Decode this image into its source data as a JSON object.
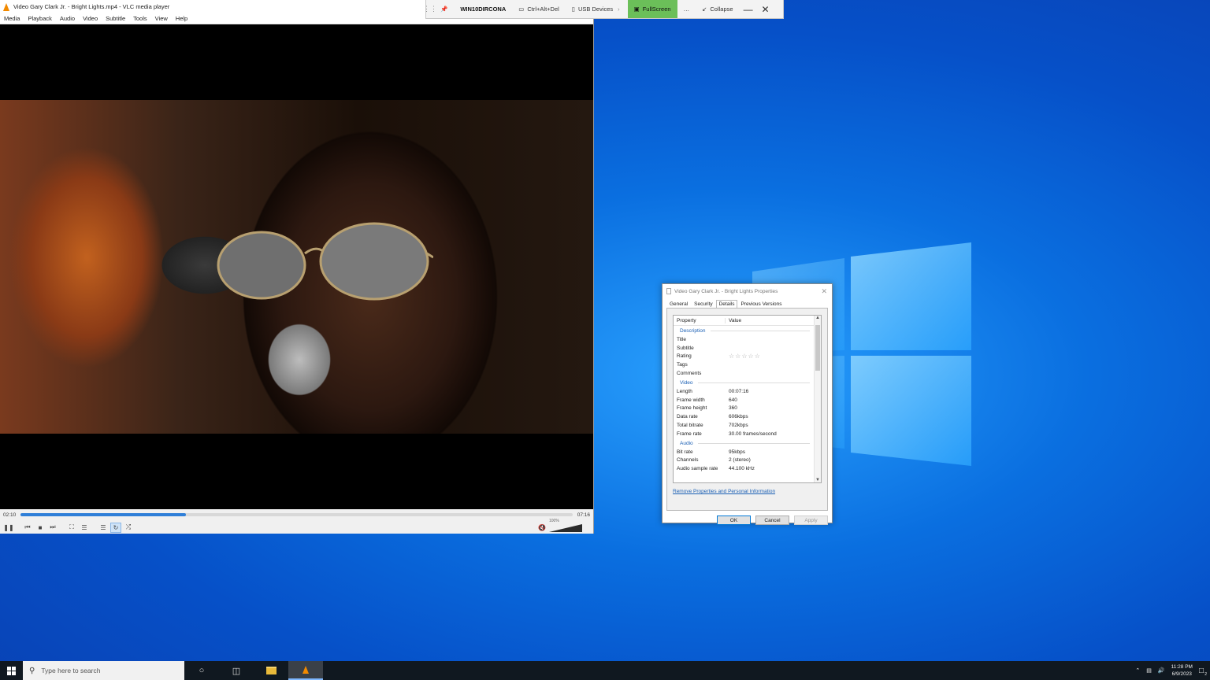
{
  "rdp_toolbar": {
    "machine": "WIN10DIRCONA",
    "ctrl_alt_del": "Ctrl+Alt+Del",
    "usb": "USB Devices",
    "fullscreen": "FullScreen",
    "more": "…",
    "collapse": "Collapse"
  },
  "vlc": {
    "title": "Video Gary Clark Jr. - Bright Lights.mp4 - VLC media player",
    "menu": [
      "Media",
      "Playback",
      "Audio",
      "Video",
      "Subtitle",
      "Tools",
      "View",
      "Help"
    ],
    "time_elapsed": "02:10",
    "time_total": "07:16",
    "progress": 0.3,
    "volume_label": "100%"
  },
  "properties": {
    "title": "Video Gary Clark Jr. - Bright Lights Properties",
    "tabs": [
      "General",
      "Security",
      "Details",
      "Previous Versions"
    ],
    "header_property": "Property",
    "header_value": "Value",
    "sections": {
      "description": "Description",
      "video": "Video",
      "audio": "Audio"
    },
    "description_rows": [
      {
        "k": "Title",
        "v": ""
      },
      {
        "k": "Subtitle",
        "v": ""
      },
      {
        "k": "Rating",
        "v": "☆☆☆☆☆"
      },
      {
        "k": "Tags",
        "v": ""
      },
      {
        "k": "Comments",
        "v": ""
      }
    ],
    "video_rows": [
      {
        "k": "Length",
        "v": "00:07:16"
      },
      {
        "k": "Frame width",
        "v": "640"
      },
      {
        "k": "Frame height",
        "v": "360"
      },
      {
        "k": "Data rate",
        "v": "606kbps"
      },
      {
        "k": "Total bitrate",
        "v": "702kbps"
      },
      {
        "k": "Frame rate",
        "v": "30.00 frames/second"
      }
    ],
    "audio_rows": [
      {
        "k": "Bit rate",
        "v": "95kbps"
      },
      {
        "k": "Channels",
        "v": "2 (stereo)"
      },
      {
        "k": "Audio sample rate",
        "v": "44.100 kHz"
      }
    ],
    "remove_link": "Remove Properties and Personal Information",
    "ok": "OK",
    "cancel": "Cancel",
    "apply": "Apply"
  },
  "taskbar": {
    "search_placeholder": "Type here to search",
    "time": "11:28 PM",
    "date": "6/9/2023",
    "notification_count": "2"
  },
  "colors": {
    "accent": "#2f7fd8",
    "fullscreen_bg": "#6bbf59",
    "desktop": "#0a6fe0"
  }
}
